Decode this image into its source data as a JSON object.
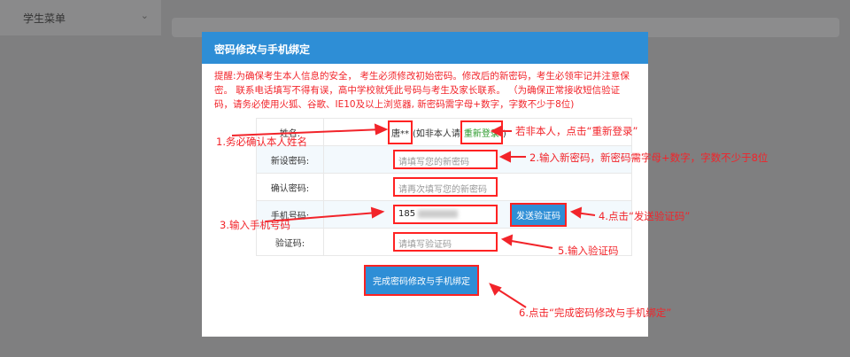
{
  "sidebar": {
    "item": "学生菜单"
  },
  "modal": {
    "title": "密码修改与手机绑定",
    "notice": "提醒:为确保考生本人信息的安全， 考生必须修改初始密码。修改后的新密码，考生必领牢记并注意保密。 联系电话填写不得有误，高中学校就凭此号码与考生及家长联系。 （为确保正常接收短信验证码，请务必使用火狐、谷歌、IE10及以上浏览器, 新密码需字母+数字，字数不少于8位)",
    "name_label": "姓名:",
    "name_value": "唐**",
    "name_hint": "(如非本人请",
    "relogin": "重新登录",
    "name_close": ")",
    "new_pw_label": "新设密码:",
    "new_pw_placeholder": "请填写您的新密码",
    "confirm_label": "确认密码:",
    "confirm_placeholder": "请再次填写您的新密码",
    "phone_label": "手机号码:",
    "phone_value": "185",
    "send_code": "发送验证码",
    "code_label": "验证码:",
    "code_placeholder": "请填写验证码",
    "submit": "完成密码修改与手机绑定"
  },
  "annotations": {
    "a1": "1.务必确认本人姓名",
    "a_relog": "若非本人，点击“重新登录”",
    "a2": "2.输入新密码，新密码需字母+数字，字数不少于8位",
    "a3": "3.输入手机号码",
    "a4": "4.点击“发送验证码”",
    "a5": "5.输入验证码",
    "a6": "6.点击“完成密码修改与手机绑定”"
  }
}
